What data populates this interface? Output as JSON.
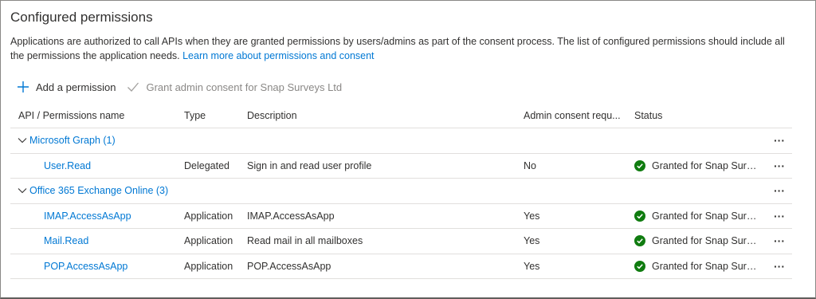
{
  "section": {
    "title": "Configured permissions",
    "description": "Applications are authorized to call APIs when they are granted permissions by users/admins as part of the consent process. The list of configured permissions should include all the permissions the application needs. ",
    "learn_more_link": "Learn more about permissions and consent"
  },
  "toolbar": {
    "add_label": "Add a permission",
    "grant_label": "Grant admin consent for Snap Surveys Ltd"
  },
  "table": {
    "headers": {
      "name": "API / Permissions name",
      "type": "Type",
      "description": "Description",
      "admin": "Admin consent requ...",
      "status": "Status"
    },
    "groups": [
      {
        "name": "Microsoft Graph (1)",
        "rows": [
          {
            "name": "User.Read",
            "type": "Delegated",
            "description": "Sign in and read user profile",
            "admin": "No",
            "status": "Granted for Snap Surve..."
          }
        ]
      },
      {
        "name": "Office 365 Exchange Online (3)",
        "rows": [
          {
            "name": "IMAP.AccessAsApp",
            "type": "Application",
            "description": "IMAP.AccessAsApp",
            "admin": "Yes",
            "status": "Granted for Snap Surve..."
          },
          {
            "name": "Mail.Read",
            "type": "Application",
            "description": "Read mail in all mailboxes",
            "admin": "Yes",
            "status": "Granted for Snap Surve..."
          },
          {
            "name": "POP.AccessAsApp",
            "type": "Application",
            "description": "POP.AccessAsApp",
            "admin": "Yes",
            "status": "Granted for Snap Surve..."
          }
        ]
      }
    ],
    "more_icon": "ellipsis-icon",
    "status_icon": "check-circle-icon"
  },
  "colors": {
    "link": "#0078d4",
    "success": "#107c10",
    "text": "#323130",
    "disabled": "#8a8886"
  }
}
